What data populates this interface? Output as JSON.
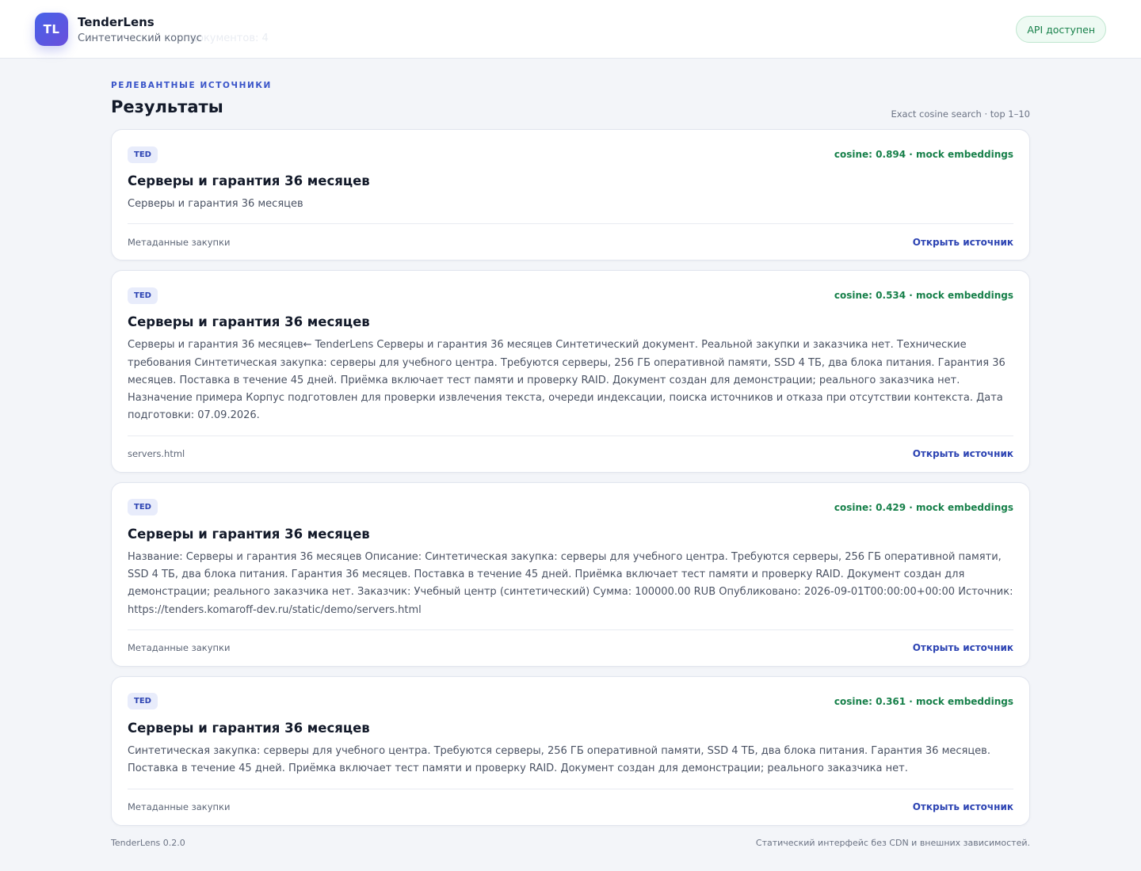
{
  "header": {
    "logo_text": "TL",
    "app_name": "TenderLens",
    "subtitle": "Синтетический корпус",
    "subtitle_ghost": "документов: 4",
    "api_status": "API доступен"
  },
  "results_section": {
    "eyebrow": "Релевантные источники",
    "title": "Результаты",
    "search_meta": "Exact cosine search · top 1–10"
  },
  "results": [
    {
      "source": "TED",
      "score": "cosine: 0.894 · mock embeddings",
      "title": "Серверы и гарантия 36 месяцев",
      "snippet": "Серверы и гарантия 36 месяцев",
      "meta": "Метаданные закупки",
      "link": "Открыть источник"
    },
    {
      "source": "TED",
      "score": "cosine: 0.534 · mock embeddings",
      "title": "Серверы и гарантия 36 месяцев",
      "snippet": "Серверы и гарантия 36 месяцев← TenderLens Серверы и гарантия 36 месяцев Синтетический документ. Реальной закупки и заказчика нет. Технические требования Синтетическая закупка: серверы для учебного центра. Требуются серверы, 256 ГБ оперативной памяти, SSD 4 ТБ, два блока питания. Гарантия 36 месяцев. Поставка в течение 45 дней. Приёмка включает тест памяти и проверку RAID. Документ создан для демонстрации; реального заказчика нет. Назначение примера Корпус подготовлен для проверки извлечения текста, очереди индексации, поиска источников и отказа при отсутствии контекста. Дата подготовки: 07.09.2026.",
      "meta": "servers.html",
      "link": "Открыть источник"
    },
    {
      "source": "TED",
      "score": "cosine: 0.429 · mock embeddings",
      "title": "Серверы и гарантия 36 месяцев",
      "snippet": "Название: Серверы и гарантия 36 месяцев Описание: Синтетическая закупка: серверы для учебного центра. Требуются серверы, 256 ГБ оперативной памяти, SSD 4 ТБ, два блока питания. Гарантия 36 месяцев. Поставка в течение 45 дней. Приёмка включает тест памяти и проверку RAID. Документ создан для демонстрации; реального заказчика нет. Заказчик: Учебный центр (синтетический) Сумма: 100000.00 RUB Опубликовано: 2026-09-01T00:00:00+00:00 Источник: https://tenders.komaroff-dev.ru/static/demo/servers.html",
      "meta": "Метаданные закупки",
      "link": "Открыть источник"
    },
    {
      "source": "TED",
      "score": "cosine: 0.361 · mock embeddings",
      "title": "Серверы и гарантия 36 месяцев",
      "snippet": "Синтетическая закупка: серверы для учебного центра. Требуются серверы, 256 ГБ оперативной памяти, SSD 4 ТБ, два блока питания. Гарантия 36 месяцев. Поставка в течение 45 дней. Приёмка включает тест памяти и проверку RAID. Документ создан для демонстрации; реального заказчика нет.",
      "meta": "Метаданные закупки",
      "link": "Открыть источник"
    }
  ],
  "footer": {
    "version": "TenderLens 0.2.0",
    "note": "Статический интерфейс без CDN и внешних зависимостей."
  },
  "colors": {
    "accent": "#3a55c9",
    "score_green": "#17804a",
    "background": "#f3f5f9"
  }
}
